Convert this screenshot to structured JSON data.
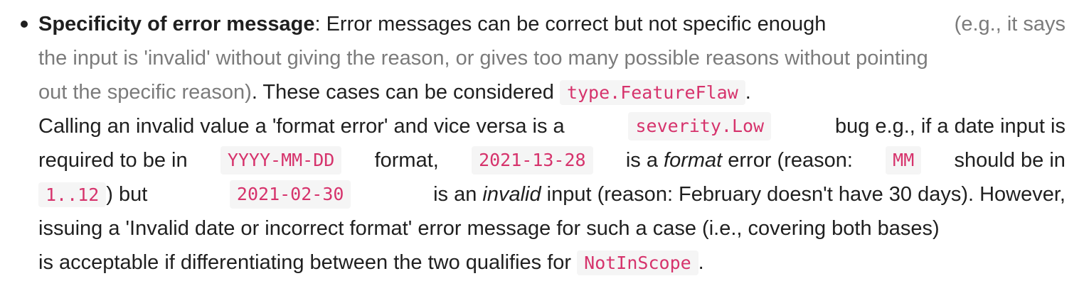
{
  "item": {
    "term": "Specificity of error message",
    "colon": ":",
    "l1_text": "Error messages can be correct but not specific enough",
    "l1_muted": "(e.g., it says",
    "l2_muted": "the input is 'invalid' without giving the reason, or gives too many possible reasons without pointing",
    "l3_muted": "out the specific reason)",
    "l3_text": ". These cases can be considered",
    "code_feature_flaw": "type.FeatureFlaw",
    "l3_end": ".",
    "l4_text": "Calling an invalid value a 'format error' and vice versa is a",
    "code_severity_low": "severity.Low",
    "l4_text2": "bug e.g., if a date input is",
    "l5_text": "required to be in",
    "code_yyyy": "YYYY-MM-DD",
    "l5_text2": "format,",
    "code_bad_month": "2021-13-28",
    "l5_text3": "is a",
    "l5_em": "format",
    "l5_text4": "error (reason:",
    "code_mm": "MM",
    "l5_text5": "should be in",
    "code_range": "1..12",
    "l6_text": ") but",
    "code_bad_day": "2021-02-30",
    "l6_text2": "is an",
    "l6_em": "invalid",
    "l6_text3": "input (reason: February doesn't have 30 days). However,",
    "l7_text": "issuing a 'Invalid date or incorrect format' error message for such a case (i.e., covering both bases)",
    "l8_text": "is acceptable if differentiating between the two qualifies for",
    "code_not_in_scope": "NotInScope",
    "l8_end": "."
  }
}
